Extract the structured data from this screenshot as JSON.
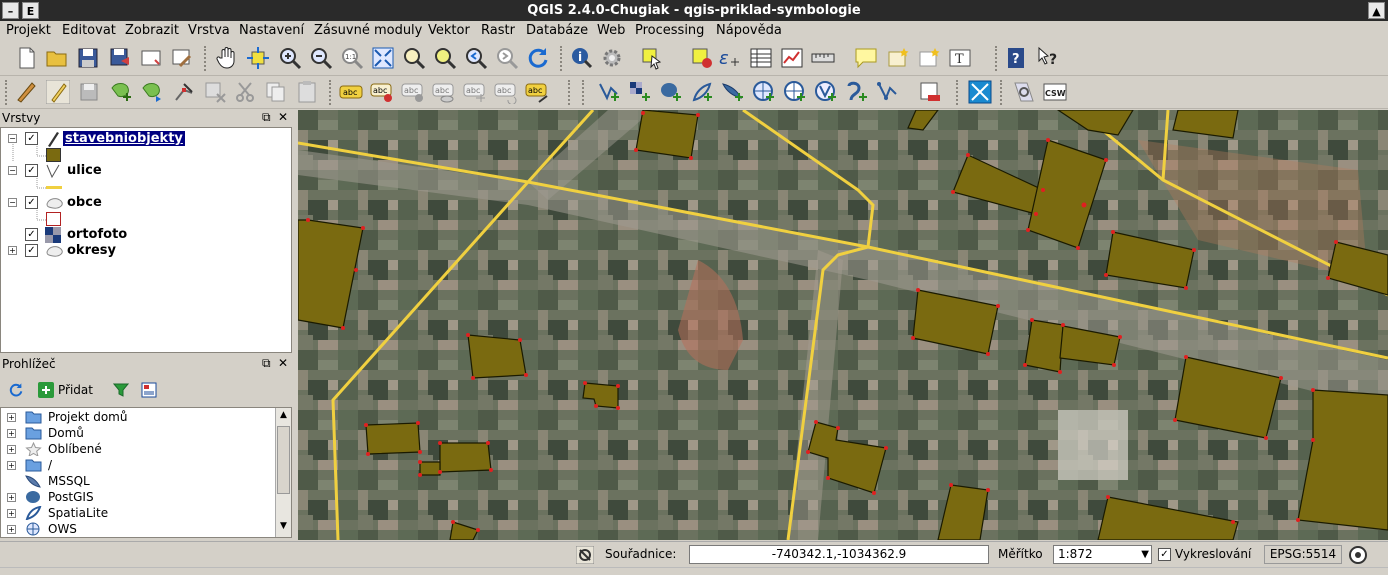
{
  "window": {
    "title": "QGIS 2.4.0-Chugiak - qgis-priklad-symbologie",
    "app_letter": "E",
    "left_ctrl": "–",
    "right_ctrl": "▲"
  },
  "menu": [
    {
      "label": "Projekt"
    },
    {
      "label": "Editovat"
    },
    {
      "label": "Zobrazit"
    },
    {
      "label": "Vrstva"
    },
    {
      "label": "Nastavení"
    },
    {
      "label": "Zásuvné moduly"
    },
    {
      "label": "Vektor"
    },
    {
      "label": "Rastr"
    },
    {
      "label": "Databáze"
    },
    {
      "label": "Web"
    },
    {
      "label": "Processing"
    },
    {
      "label": "Nápověda"
    }
  ],
  "layers_panel": {
    "title": "Vrstvy",
    "items": [
      {
        "name": "stavebniobjekty",
        "checked": true,
        "selected": true,
        "symbol_color": "#7a6a10"
      },
      {
        "name": "ulice",
        "checked": true,
        "symbol_color": "#f0d040"
      },
      {
        "name": "obce",
        "checked": true,
        "symbol_color": "#b22222"
      },
      {
        "name": "ortofoto",
        "checked": true
      },
      {
        "name": "okresy",
        "checked": true
      }
    ]
  },
  "browser_panel": {
    "title": "Prohlížeč",
    "add_label": "Přidat",
    "items": [
      {
        "name": "Projekt domů",
        "icon": "folder-icon"
      },
      {
        "name": "Domů",
        "icon": "folder-icon"
      },
      {
        "name": "Oblíbené",
        "icon": "star-icon"
      },
      {
        "name": "/",
        "icon": "folder-icon"
      },
      {
        "name": "MSSQL",
        "icon": "mssql-icon"
      },
      {
        "name": "PostGIS",
        "icon": "postgis-icon"
      },
      {
        "name": "SpatiaLite",
        "icon": "spatialite-icon"
      },
      {
        "name": "OWS",
        "icon": "globe-icon"
      }
    ]
  },
  "status": {
    "coords_label": "Souřadnice:",
    "coords_value": "-740342.1,-1034362.9",
    "scale_label": "Měřítko",
    "scale_value": "1:872",
    "render_label": "Vykreslování",
    "render_checked": true,
    "crs": "EPSG:5514"
  },
  "toolbar2_labels": {
    "abc": "abc",
    "csw": "CSW"
  },
  "colors": {
    "building_fill": "#7a6a10",
    "street": "#f0d040",
    "vertex": "#e02020",
    "selection": "#000080"
  }
}
